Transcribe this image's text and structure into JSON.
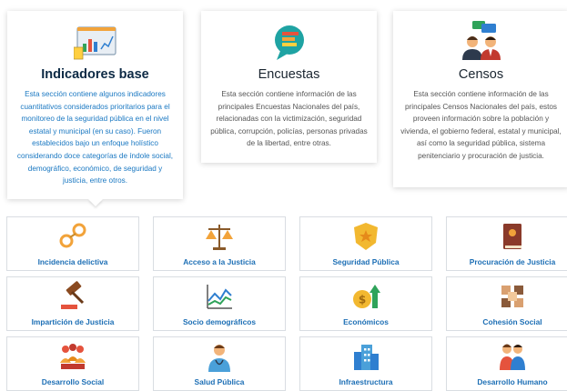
{
  "feature_cards": [
    {
      "title": "Indicadores base",
      "icon": "chart-screen-icon",
      "description": "Esta sección contiene algunos indicadores cuantitativos considerados prioritarios para el monitoreo de la seguridad pública en el nivel estatal y municipal (en su caso). Fueron establecidos bajo un enfoque holístico considerando doce categorías de índole social, demográfico, económico, de seguridad y justicia, entre otros.",
      "selected": true
    },
    {
      "title": "Encuestas",
      "icon": "survey-chat-icon",
      "description": "Esta sección contiene información de las principales Encuestas Nacionales del país, relacionadas con la victimización, seguridad pública, corrupción, policías, personas privadas de la libertad, entre otras."
    },
    {
      "title": "Censos",
      "icon": "people-census-icon",
      "description": "Esta sección contiene información de las principales Censos Nacionales del país, estos proveen información sobre la población y vivienda, el gobierno federal, estatal y municipal, así como la seguridad pública, sistema penitenciario y procuración de justicia."
    }
  ],
  "categories": [
    {
      "label": "Incidencia delictiva",
      "icon": "handcuffs-icon"
    },
    {
      "label": "Acceso a la Justicia",
      "icon": "scales-icon"
    },
    {
      "label": "Seguridad Pública",
      "icon": "police-badge-icon"
    },
    {
      "label": "Procuración de Justicia",
      "icon": "law-book-icon"
    },
    {
      "label": "Impartición de Justicia",
      "icon": "gavel-icon"
    },
    {
      "label": "Socio demográficos",
      "icon": "line-chart-icon"
    },
    {
      "label": "Económicos",
      "icon": "coin-growth-icon"
    },
    {
      "label": "Cohesión Social",
      "icon": "handshake-icon"
    },
    {
      "label": "Desarrollo Social",
      "icon": "community-icon"
    },
    {
      "label": "Salud Pública",
      "icon": "doctor-icon"
    },
    {
      "label": "Infraestructura",
      "icon": "building-icon"
    },
    {
      "label": "Desarrollo Humano",
      "icon": "family-icon"
    }
  ],
  "colors": {
    "accent_blue": "#1d6fb5",
    "active_text": "#1a78c2",
    "title_dark": "#0d2a45"
  }
}
